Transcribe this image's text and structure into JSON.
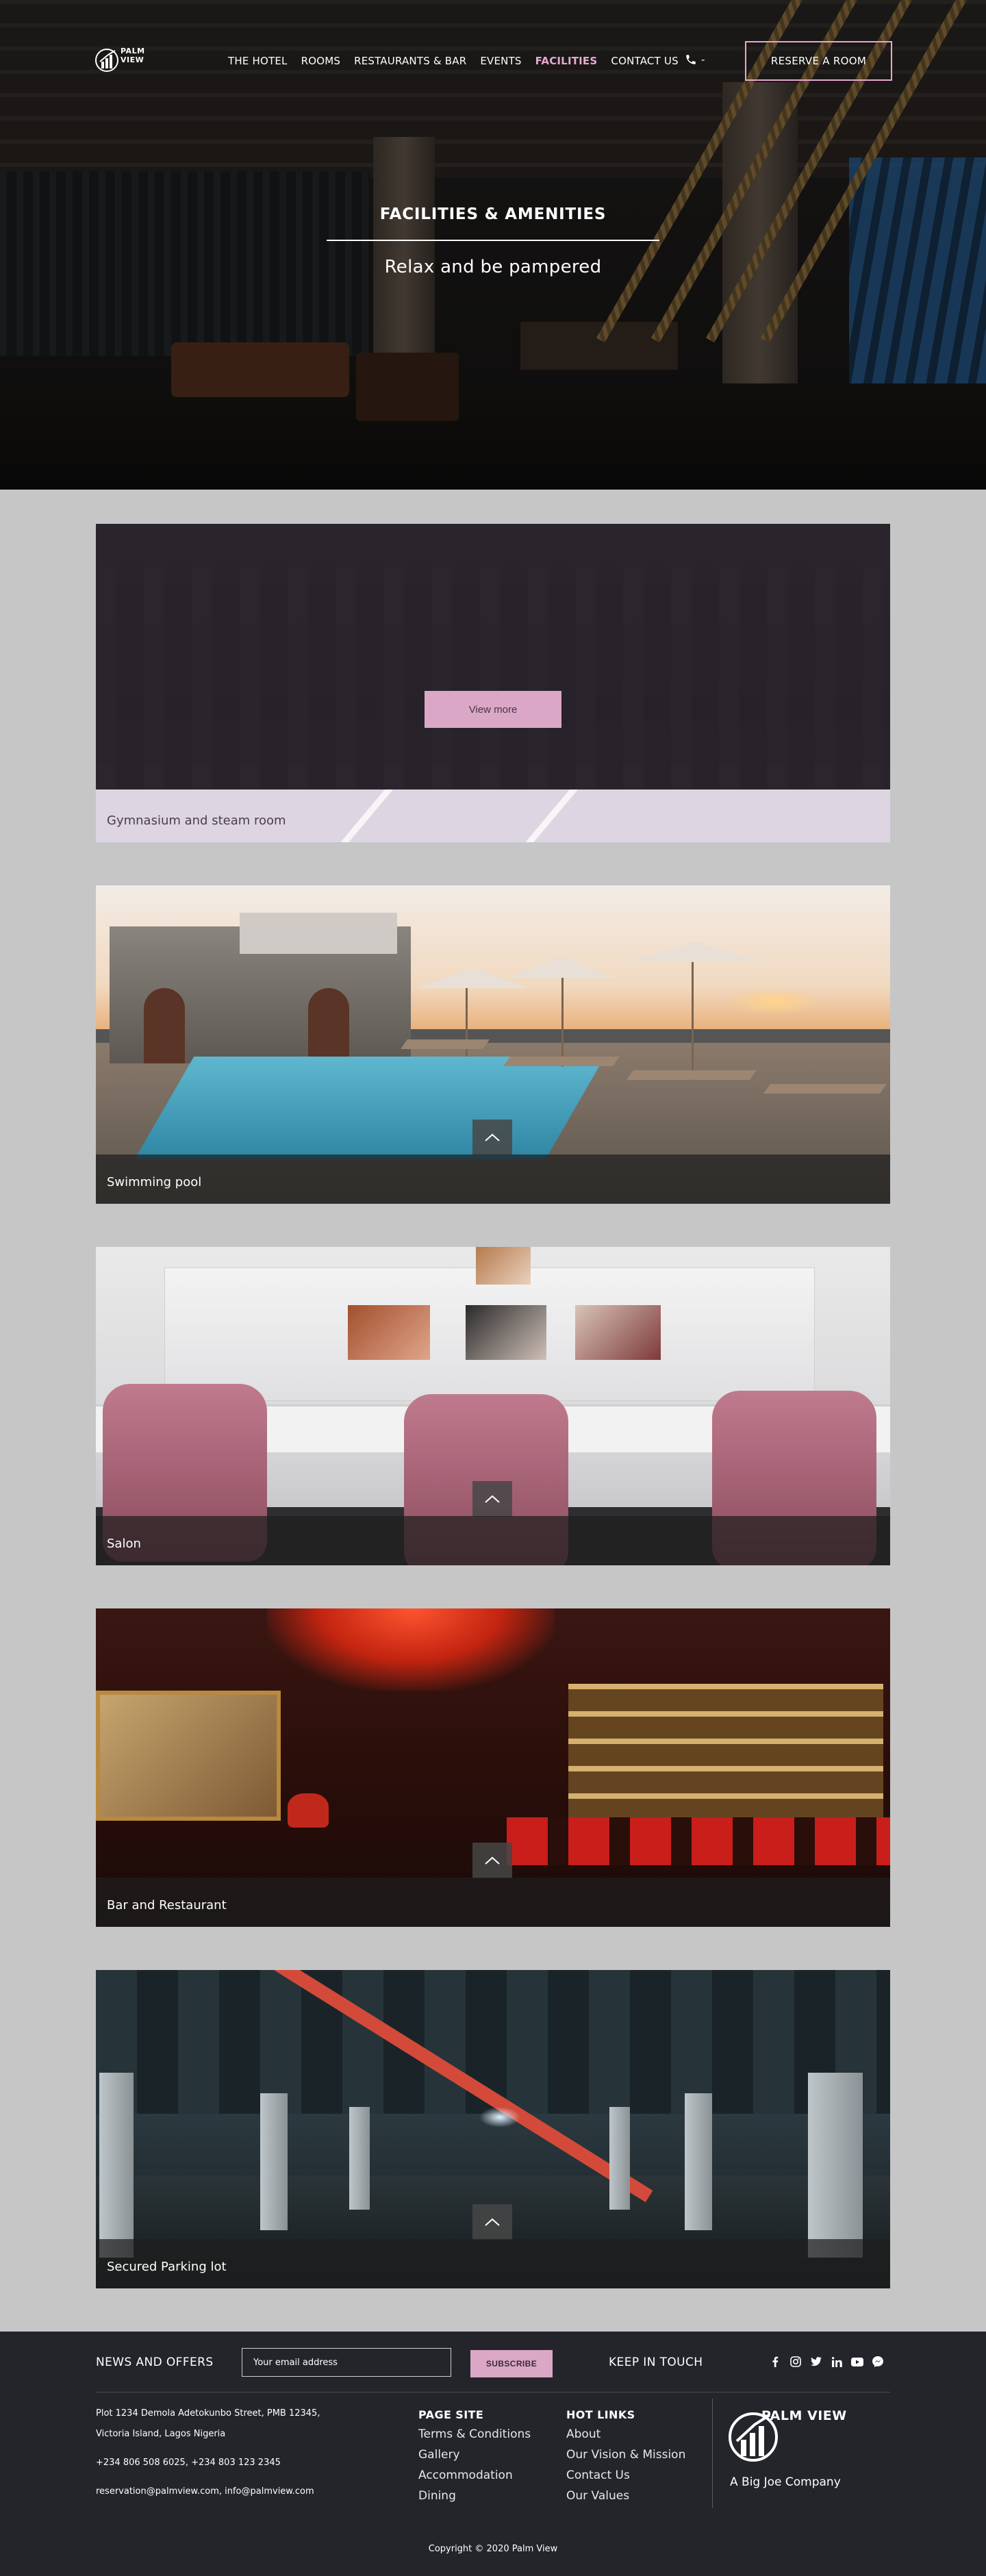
{
  "nav": {
    "brand": "PALM VIEW",
    "items": [
      {
        "label": "THE HOTEL",
        "active": false
      },
      {
        "label": "ROOMS",
        "active": false
      },
      {
        "label": "RESTAURANTS & BAR",
        "active": false
      },
      {
        "label": "EVENTS",
        "active": false
      },
      {
        "label": "FACILITIES",
        "active": true
      },
      {
        "label": "CONTACT US",
        "active": false
      }
    ],
    "phone_suffix": "-",
    "reserve_label": "RESERVE A ROOM",
    "accent": "#e6a9cf"
  },
  "hero": {
    "title": "FACILITIES & AMENITIES",
    "subtitle": "Relax and be pampered"
  },
  "cards": [
    {
      "caption": "Gymnasium and steam room",
      "button": "View more"
    },
    {
      "caption": "Swimming pool"
    },
    {
      "caption": "Salon"
    },
    {
      "caption": "Bar and Restaurant"
    },
    {
      "caption": "Secured Parking lot"
    }
  ],
  "footer": {
    "news_title": "NEWS AND OFFERS",
    "email_placeholder": "Your email address",
    "subscribe_label": "SUBSCRIBE",
    "keep_in_touch": "KEEP IN TOUCH",
    "social_icons": [
      "facebook-icon",
      "instagram-icon",
      "twitter-icon",
      "linkedin-icon",
      "youtube-icon",
      "messenger-icon"
    ],
    "address_line1": "Plot 1234 Demola Adetokunbo Street, PMB 12345,",
    "address_line2": "Victoria Island, Lagos Nigeria",
    "phones": "+234 806 508 6025, +234 803 123 2345",
    "emails": "reservation@palmview.com, info@palmview.com",
    "page_site_title": "PAGE SITE",
    "page_site_links": [
      "Terms & Conditions",
      "Gallery",
      "Accommodation",
      "Dining"
    ],
    "hot_links_title": "HOT LINKS",
    "hot_links": [
      "About",
      "Our Vision & Mission",
      "Contact Us",
      "Our Values"
    ],
    "logo_text": "PALM VIEW",
    "company": "A Big Joe Company",
    "copyright": "Copyright © 2020 Palm View"
  }
}
